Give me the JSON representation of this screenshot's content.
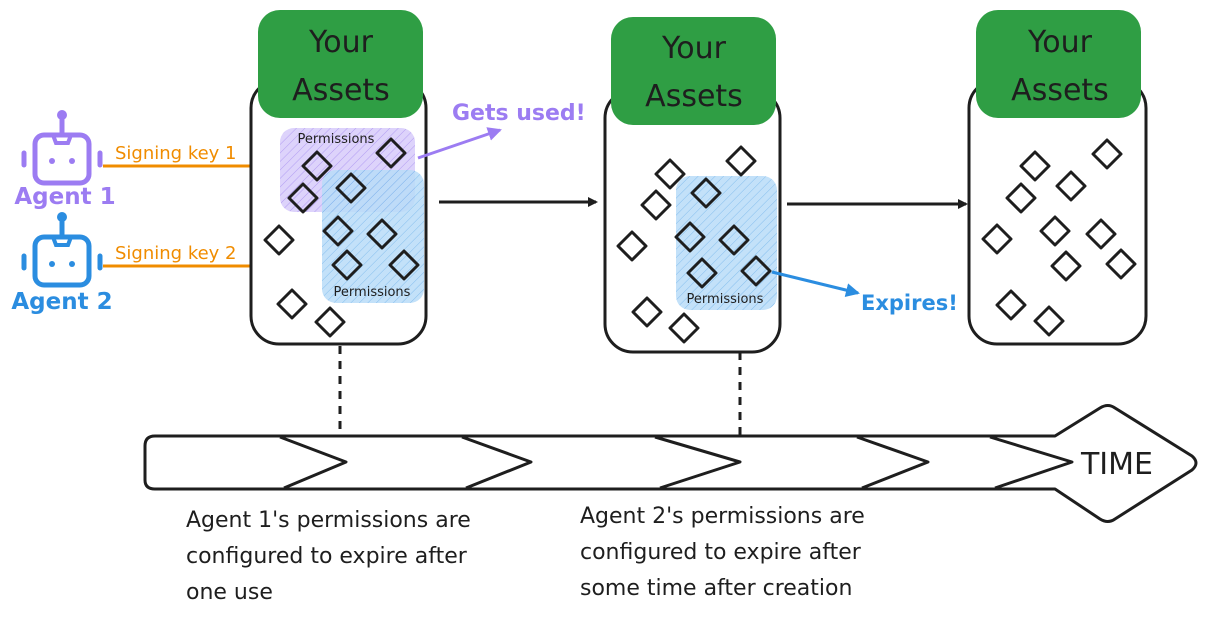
{
  "colors": {
    "agent1": "#9c7cf2",
    "agent2": "#2b8de0",
    "signing_key": "#f08c00",
    "asset_header": "#2f9e44",
    "ink": "#1e1e1e",
    "perm1_fill": "#c9b8f7",
    "perm2_fill": "#a5d1f5"
  },
  "agents": [
    {
      "label": "Agent 1",
      "icon": "robot-icon",
      "key_label": "Signing key 1"
    },
    {
      "label": "Agent 2",
      "icon": "robot-icon",
      "key_label": "Signing key 2"
    }
  ],
  "jars": [
    {
      "title_line1": "Your",
      "title_line2": "Assets",
      "permissions": [
        "Permissions",
        "Permissions"
      ]
    },
    {
      "title_line1": "Your",
      "title_line2": "Assets",
      "permissions": [
        "Permissions"
      ]
    },
    {
      "title_line1": "Your",
      "title_line2": "Assets",
      "permissions": []
    }
  ],
  "events": {
    "used": "Gets used!",
    "expires": "Expires!"
  },
  "timeline": {
    "label": "TIME"
  },
  "captions": [
    "Agent 1's permissions are\nconfigured to expire after\none use",
    "Agent 2's permissions are\nconfigured to expire after\nsome time after creation"
  ]
}
